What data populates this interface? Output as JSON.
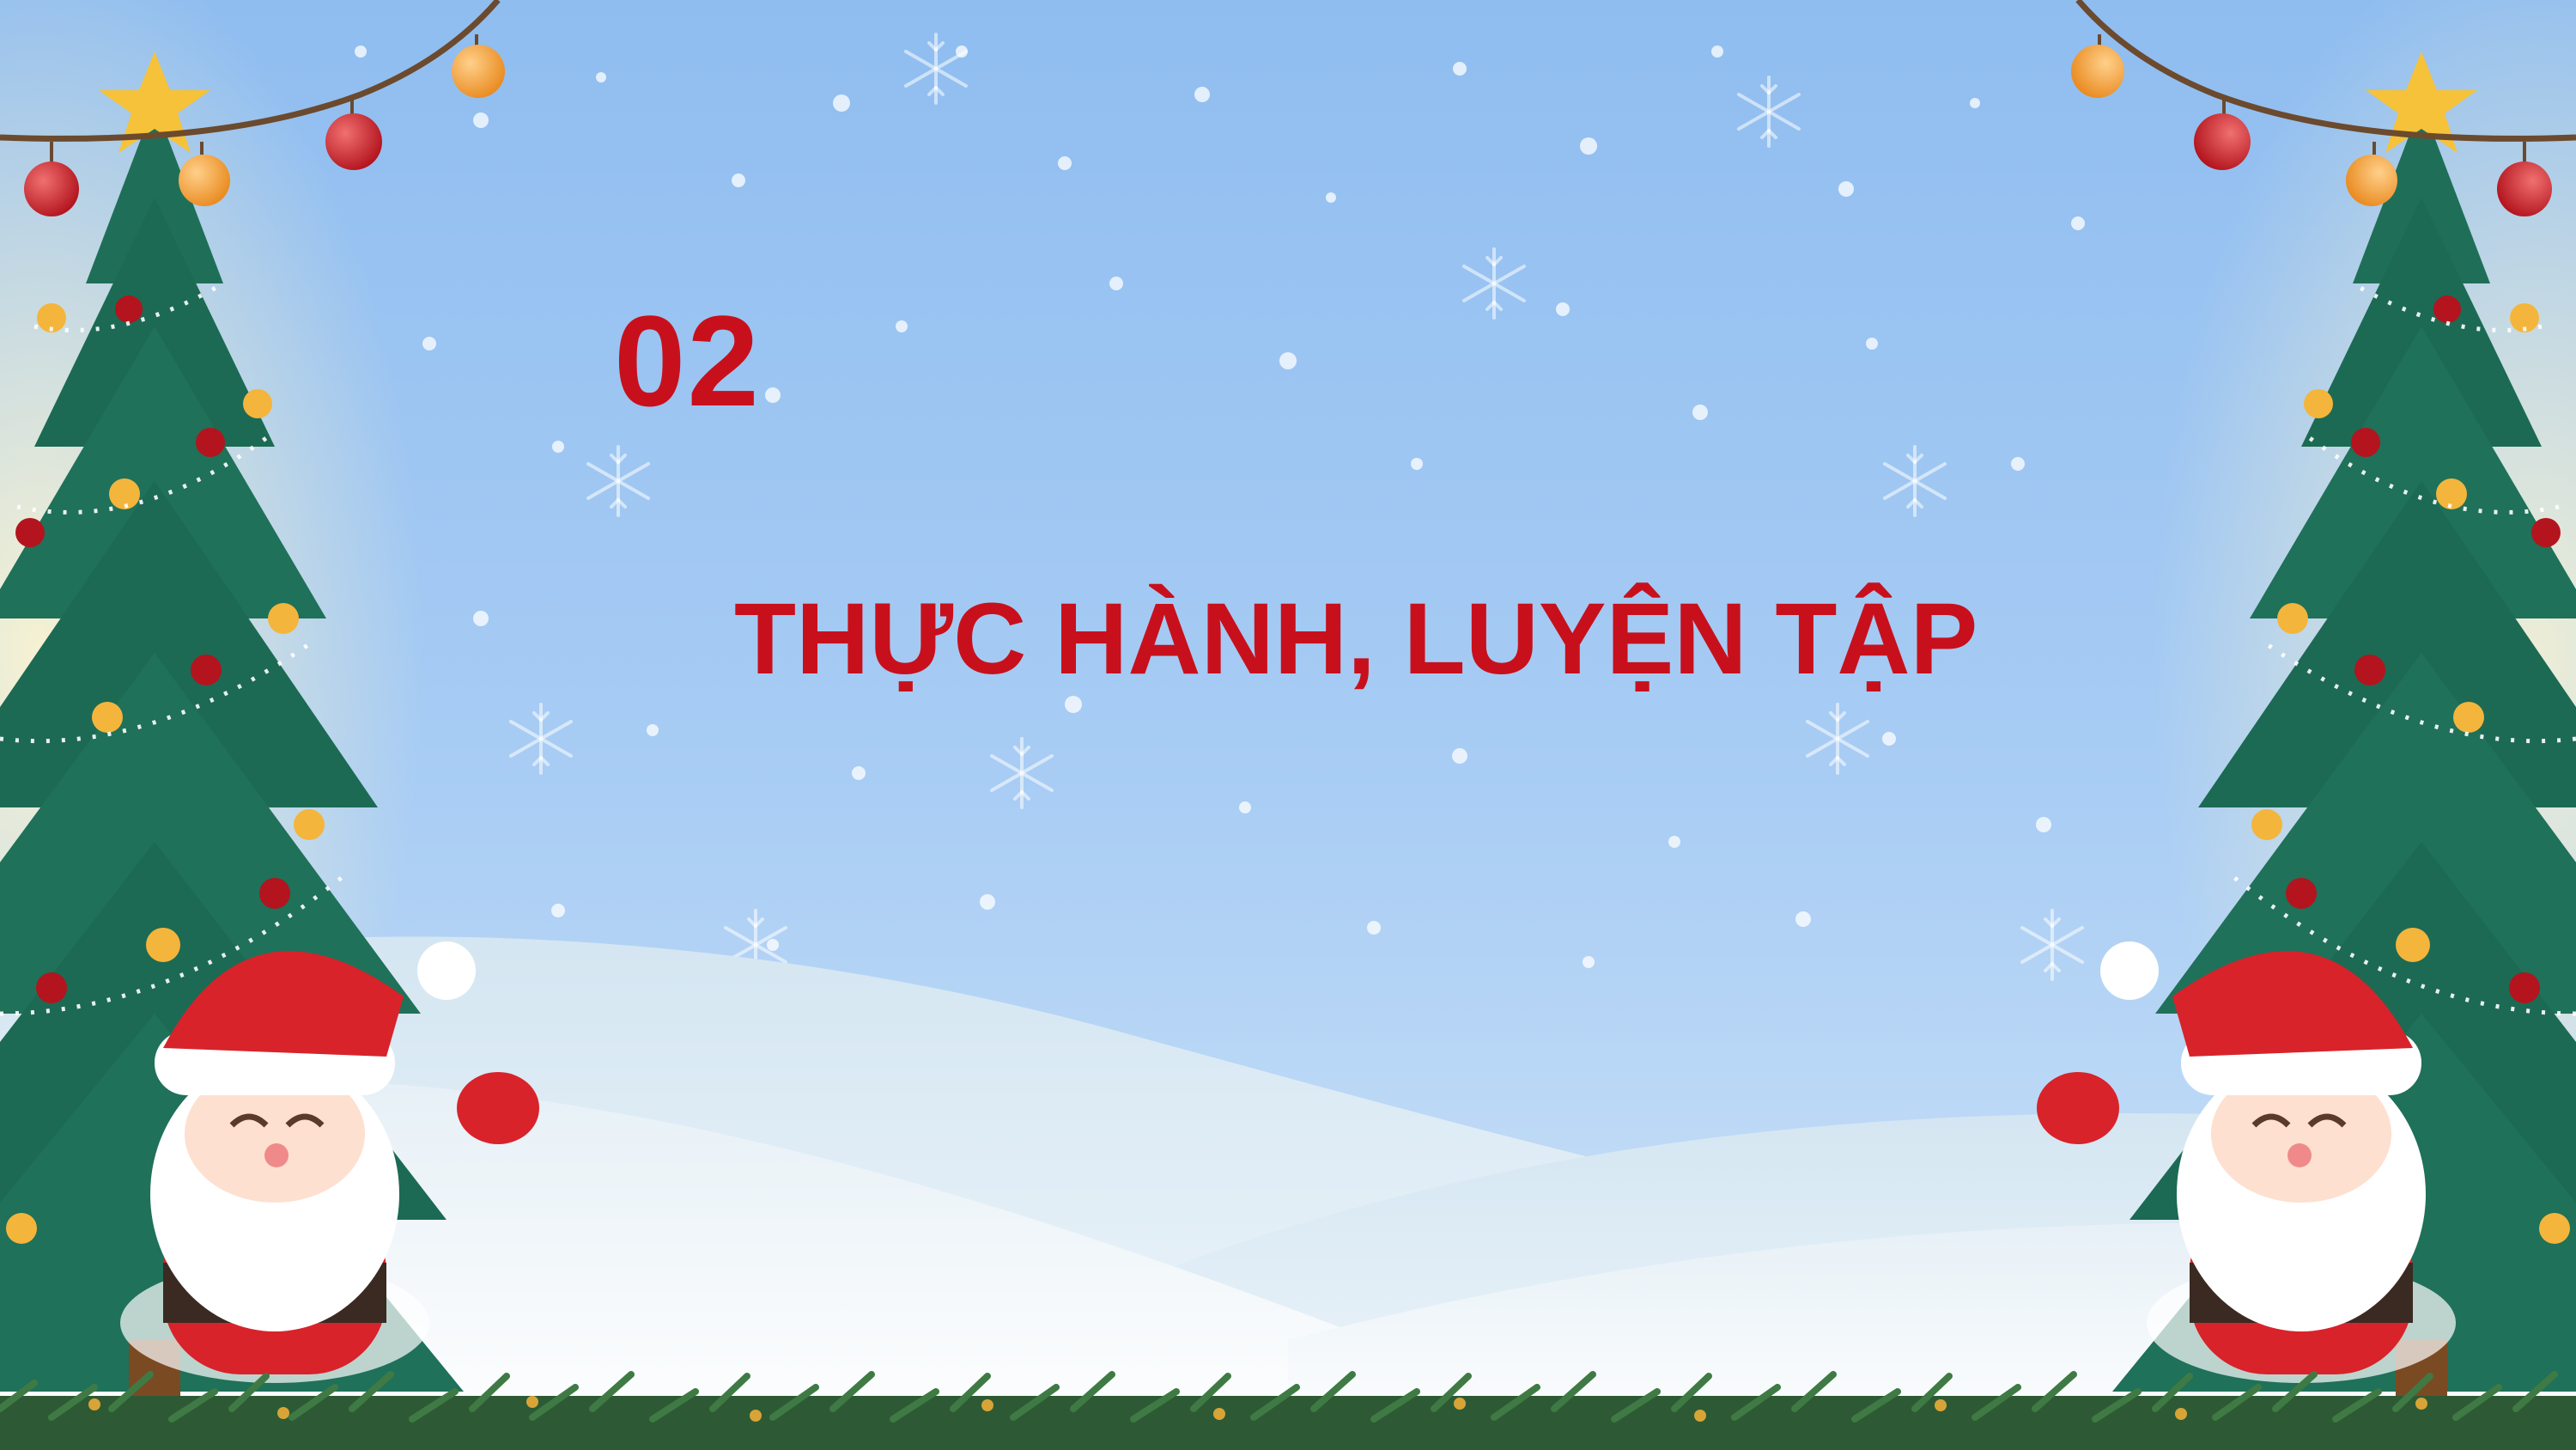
{
  "slide": {
    "section_number": "02",
    "section_title": "THỰC HÀNH, LUYỆN TẬP"
  },
  "theme": {
    "title_color": "#c8101c",
    "sky_top": "#8fbdf0",
    "sky_bottom": "#c6def8",
    "snow": "#f2f7fb",
    "tree": "#1e6e58",
    "santa_red": "#d8232a"
  },
  "decorations": [
    "christmas-tree-left",
    "christmas-tree-right",
    "santa-left",
    "santa-right",
    "light-garland-left",
    "light-garland-right",
    "snow-hills",
    "pine-garland-bottom",
    "snowflakes"
  ]
}
